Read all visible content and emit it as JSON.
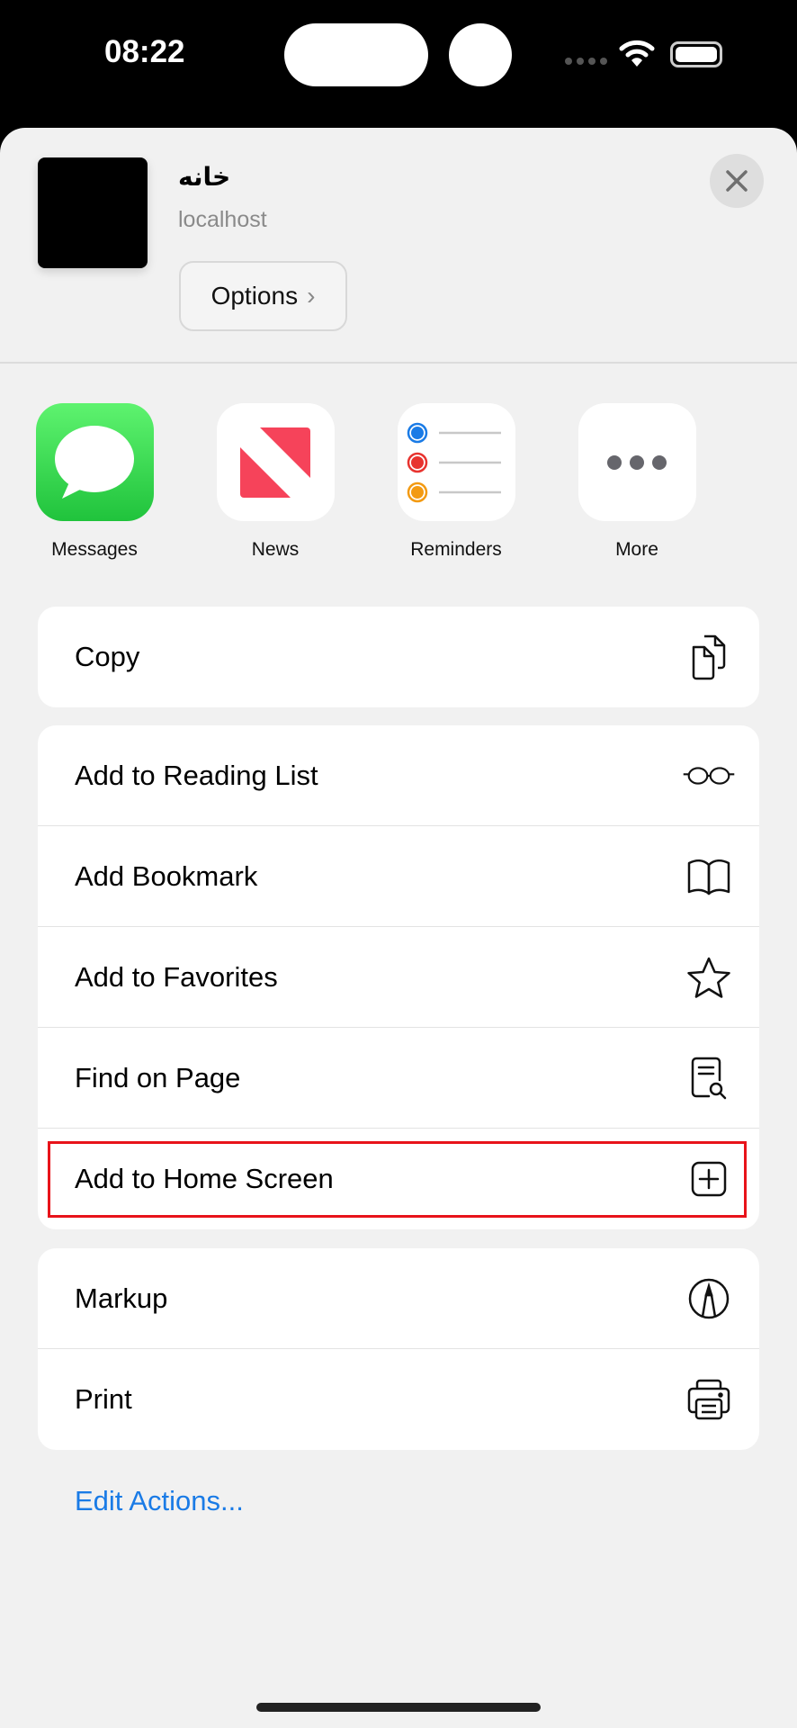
{
  "status_bar": {
    "time": "08:22"
  },
  "header": {
    "title": "خانه",
    "subtitle": "localhost",
    "options_label": "Options",
    "options_chevron": "›"
  },
  "apps": [
    {
      "label": "Messages",
      "icon": "messages-icon",
      "color": "#2fcf4c"
    },
    {
      "label": "News",
      "icon": "news-icon",
      "color": "#f6435a"
    },
    {
      "label": "Reminders",
      "icon": "reminders-icon"
    },
    {
      "label": "More",
      "icon": "more-icon"
    }
  ],
  "groups": [
    [
      {
        "label": "Copy",
        "icon": "copy-icon"
      }
    ],
    [
      {
        "label": "Add to Reading List",
        "icon": "glasses-icon"
      },
      {
        "label": "Add Bookmark",
        "icon": "book-icon"
      },
      {
        "label": "Add to Favorites",
        "icon": "star-icon"
      },
      {
        "label": "Find on Page",
        "icon": "find-on-page-icon"
      },
      {
        "label": "Add to Home Screen",
        "icon": "plus-square-icon",
        "highlighted": true
      }
    ],
    [
      {
        "label": "Markup",
        "icon": "markup-icon"
      },
      {
        "label": "Print",
        "icon": "printer-icon"
      }
    ]
  ],
  "edit_actions": "Edit Actions...",
  "colors": {
    "accent": "#1a7be6",
    "highlight": "#e8131a"
  }
}
